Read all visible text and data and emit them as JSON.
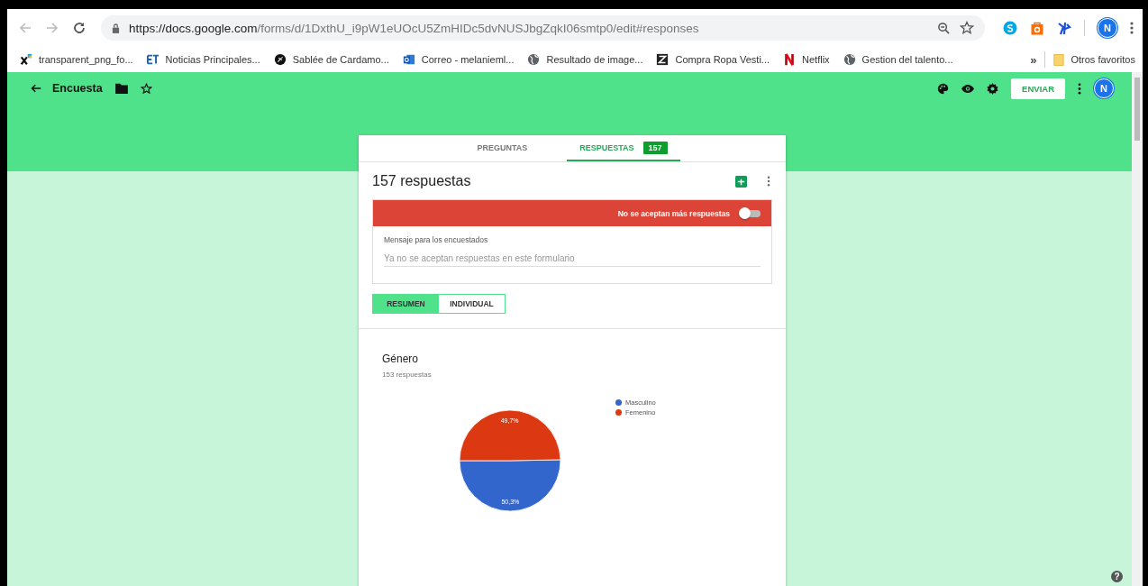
{
  "browser": {
    "url_host": "https://docs.google.com",
    "url_path": "/forms/d/1DxthU_i9pW1eUOcU5ZmHIDc5dvNUSJbgZqkI06smtp0/edit#responses",
    "profile": "N",
    "bookmarks": [
      {
        "label": "transparent_png_fo...",
        "kind": "x"
      },
      {
        "label": "Noticias Principales...",
        "kind": "et"
      },
      {
        "label": "Sablée de Cardamo...",
        "kind": "dark"
      },
      {
        "label": "Correo - melanieml...",
        "kind": "mail"
      },
      {
        "label": "Resultado de image...",
        "kind": "globe"
      },
      {
        "label": "Compra Ropa Vesti...",
        "kind": "z"
      },
      {
        "label": "Netflix",
        "kind": "n"
      },
      {
        "label": "Gestion del talento...",
        "kind": "globe"
      }
    ],
    "more": "»",
    "other_bookmarks": "Otros favoritos"
  },
  "app_bar": {
    "title": "Encuesta",
    "send": "ENVIAR",
    "avatar": "N"
  },
  "help": "?",
  "tabs": [
    {
      "label": "PREGUNTAS",
      "selected": false
    },
    {
      "label": "RESPUESTAS",
      "selected": true,
      "badge": "157"
    }
  ],
  "responses": {
    "title": "157 respuestas",
    "banner": "No se aceptan más respuestas",
    "accepting": {
      "on": false
    },
    "message_label": "Mensaje para los encuestados",
    "message_value": "Ya no se aceptan respuestas en este formulario"
  },
  "views": [
    {
      "label": "RESUMEN",
      "selected": true
    },
    {
      "label": "INDIVIDUAL",
      "selected": false
    }
  ],
  "question": {
    "title": "Género",
    "count": "153 respuestas",
    "chart_data": {
      "type": "pie",
      "legend": "right",
      "categories": [
        "Masculino",
        "Femenino"
      ],
      "values": [
        50.3,
        49.7
      ],
      "colors": [
        "#3366cc",
        "#dc3912"
      ],
      "value_labels": [
        "50,3%",
        "49,7%"
      ]
    }
  }
}
